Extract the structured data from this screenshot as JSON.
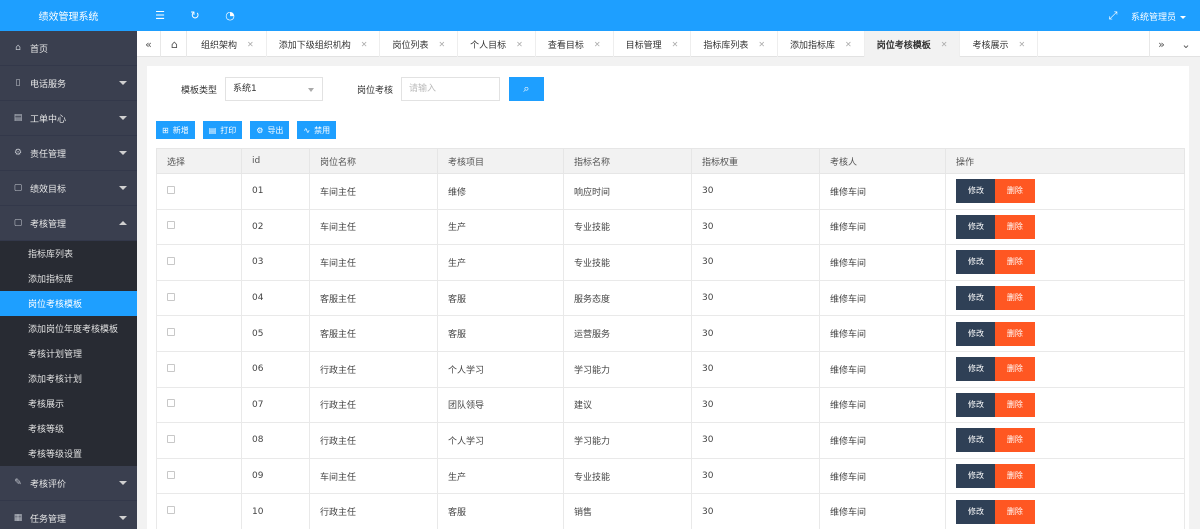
{
  "app": {
    "title": "绩效管理系统",
    "user": "系统管理员"
  },
  "sidebar": {
    "items": [
      {
        "label": "首页",
        "icon": "home-icon",
        "has_arrow": false
      },
      {
        "label": "电话服务",
        "icon": "phone-icon",
        "has_arrow": true
      },
      {
        "label": "工单中心",
        "icon": "document-icon",
        "has_arrow": true
      },
      {
        "label": "责任管理",
        "icon": "gear-icon",
        "has_arrow": true
      },
      {
        "label": "绩效目标",
        "icon": "file-icon",
        "has_arrow": true
      },
      {
        "label": "考核管理",
        "icon": "file-icon",
        "has_arrow": true,
        "expanded": true
      }
    ],
    "submenu": [
      {
        "label": "指标库列表"
      },
      {
        "label": "添加指标库"
      },
      {
        "label": "岗位考核模板",
        "active": true
      },
      {
        "label": "添加岗位年度考核模板"
      },
      {
        "label": "考核计划管理"
      },
      {
        "label": "添加考核计划"
      },
      {
        "label": "考核展示"
      },
      {
        "label": "考核等级"
      },
      {
        "label": "考核等级设置"
      }
    ],
    "items_after": [
      {
        "label": "考核评价",
        "icon": "edit-icon",
        "has_arrow": true
      },
      {
        "label": "任务管理",
        "icon": "task-icon",
        "has_arrow": true
      }
    ]
  },
  "tabs": [
    {
      "label": "组织架构"
    },
    {
      "label": "添加下级组织机构"
    },
    {
      "label": "岗位列表"
    },
    {
      "label": "个人目标"
    },
    {
      "label": "查看目标"
    },
    {
      "label": "目标管理"
    },
    {
      "label": "指标库列表"
    },
    {
      "label": "添加指标库"
    },
    {
      "label": "岗位考核模板",
      "active": true
    },
    {
      "label": "考核展示"
    }
  ],
  "filters": {
    "template_type_label": "模板类型",
    "template_type_value": "系统1",
    "post_label": "岗位考核",
    "post_placeholder": "请输入"
  },
  "toolbar": {
    "add": "新增",
    "print": "打印",
    "export": "导出",
    "disable": "禁用"
  },
  "table": {
    "headers": [
      "选择",
      "id",
      "岗位名称",
      "考核项目",
      "指标名称",
      "指标权重",
      "考核人",
      "操作"
    ],
    "edit_label": "修改",
    "delete_label": "删除",
    "rows": [
      [
        "01",
        "车间主任",
        "维修",
        "响应时间",
        "30",
        "维修车间"
      ],
      [
        "02",
        "车间主任",
        "生产",
        "专业技能",
        "30",
        "维修车间"
      ],
      [
        "03",
        "车间主任",
        "生产",
        "专业技能",
        "30",
        "维修车间"
      ],
      [
        "04",
        "客服主任",
        "客服",
        "服务态度",
        "30",
        "维修车间"
      ],
      [
        "05",
        "客服主任",
        "客服",
        "运营服务",
        "30",
        "维修车间"
      ],
      [
        "06",
        "行政主任",
        "个人学习",
        "学习能力",
        "30",
        "维修车间"
      ],
      [
        "07",
        "行政主任",
        "团队领导",
        "建议",
        "30",
        "维修车间"
      ],
      [
        "08",
        "行政主任",
        "个人学习",
        "学习能力",
        "30",
        "维修车间"
      ],
      [
        "09",
        "车间主任",
        "生产",
        "专业技能",
        "30",
        "维修车间"
      ],
      [
        "10",
        "行政主任",
        "客服",
        "销售",
        "30",
        "维修车间"
      ]
    ]
  },
  "colors": {
    "primary": "#1e9fff",
    "sidebar": "#3a3f4f",
    "submenu": "#282b33",
    "edit": "#2f4056",
    "delete": "#ff5722"
  }
}
